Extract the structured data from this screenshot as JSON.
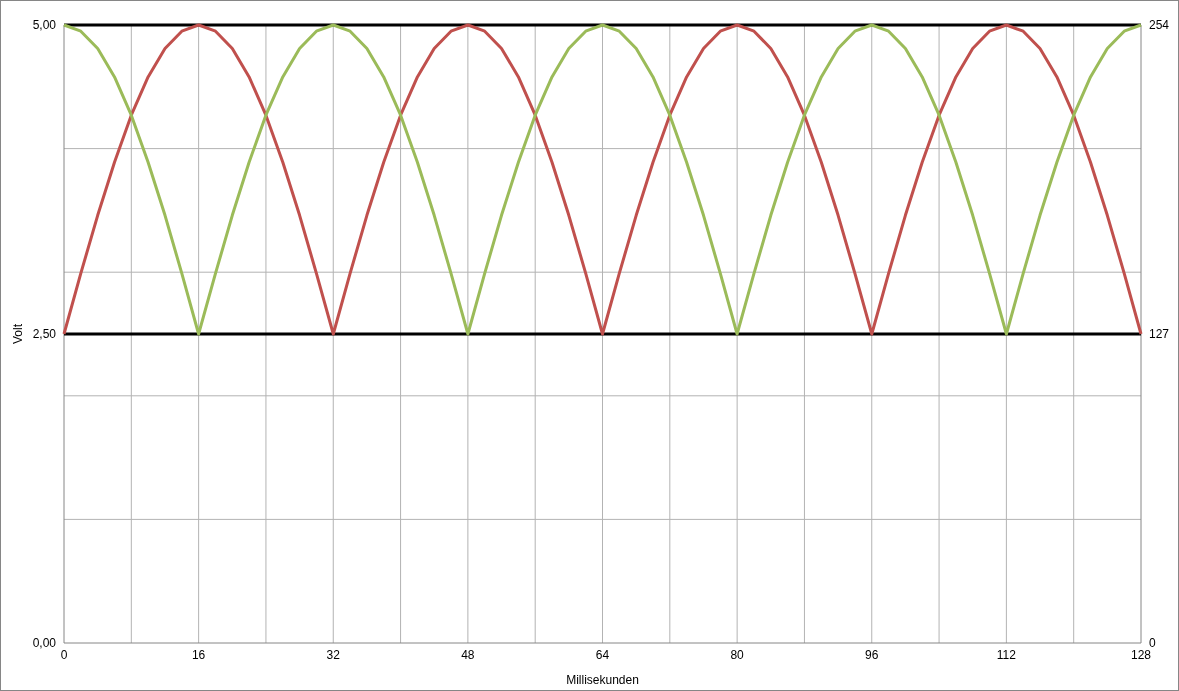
{
  "chart": {
    "chart_data": {
      "type": "line",
      "xlabel": "Millisekunden",
      "ylabel": "Volt",
      "x": [
        0,
        2,
        4,
        6,
        8,
        10,
        12,
        14,
        16,
        18,
        20,
        22,
        24,
        26,
        28,
        30,
        32,
        34,
        36,
        38,
        40,
        42,
        44,
        46,
        48,
        50,
        52,
        54,
        56,
        58,
        60,
        62,
        64,
        66,
        68,
        70,
        72,
        74,
        76,
        78,
        80,
        82,
        84,
        86,
        88,
        90,
        92,
        94,
        96,
        98,
        100,
        102,
        104,
        106,
        108,
        110,
        112,
        114,
        116,
        118,
        120,
        122,
        124,
        126,
        128
      ],
      "series": [
        {
          "color": "#c0504d",
          "values": [
            2.5,
            2.99,
            3.46,
            3.89,
            4.27,
            4.58,
            4.81,
            4.95,
            5,
            4.95,
            4.81,
            4.58,
            4.27,
            3.89,
            3.46,
            2.99,
            2.5,
            2.99,
            3.46,
            3.89,
            4.27,
            4.58,
            4.81,
            4.95,
            5,
            4.95,
            4.81,
            4.58,
            4.27,
            3.89,
            3.46,
            2.99,
            2.5,
            2.99,
            3.46,
            3.89,
            4.27,
            4.58,
            4.81,
            4.95,
            5,
            4.95,
            4.81,
            4.58,
            4.27,
            3.89,
            3.46,
            2.99,
            2.5,
            2.99,
            3.46,
            3.89,
            4.27,
            4.58,
            4.81,
            4.95,
            5,
            4.95,
            4.81,
            4.58,
            4.27,
            3.89,
            3.46,
            2.99,
            2.5
          ]
        },
        {
          "color": "#9bbb59",
          "values": [
            5,
            4.95,
            4.81,
            4.58,
            4.27,
            3.89,
            3.46,
            2.99,
            2.5,
            2.99,
            3.46,
            3.89,
            4.27,
            4.58,
            4.81,
            4.95,
            5,
            4.95,
            4.81,
            4.58,
            4.27,
            3.89,
            3.46,
            2.99,
            2.5,
            2.99,
            3.46,
            3.89,
            4.27,
            4.58,
            4.81,
            4.95,
            5,
            4.95,
            4.81,
            4.58,
            4.27,
            3.89,
            3.46,
            2.99,
            2.5,
            2.99,
            3.46,
            3.89,
            4.27,
            4.58,
            4.81,
            4.95,
            5,
            4.95,
            4.81,
            4.58,
            4.27,
            3.89,
            3.46,
            2.99,
            2.5,
            2.99,
            3.46,
            3.89,
            4.27,
            4.58,
            4.81,
            4.95,
            5
          ]
        }
      ],
      "xlim": [
        0,
        128
      ],
      "ylim": [
        0,
        5
      ],
      "xticks": [
        0,
        16,
        32,
        48,
        64,
        80,
        96,
        112,
        128
      ],
      "yticks": [
        {
          "value": 0,
          "label": "0,00"
        },
        {
          "value": 2.5,
          "label": "2,50"
        },
        {
          "value": 5,
          "label": "5,00"
        }
      ],
      "y2lim": [
        0,
        254
      ],
      "y2ticks": [
        0,
        127,
        254
      ],
      "grid": true,
      "ref_lines": [
        {
          "axis": "y",
          "value": 2.5
        },
        {
          "axis": "y",
          "value": 5
        }
      ]
    }
  }
}
